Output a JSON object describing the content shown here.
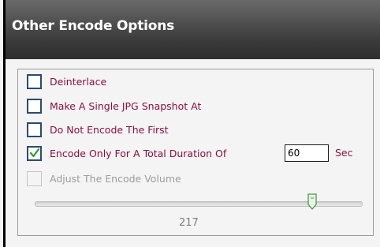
{
  "panel": {
    "title": "Other Encode Options"
  },
  "options": [
    {
      "label": "Deinterlace",
      "checked": false,
      "enabled": true
    },
    {
      "label": "Make A Single JPG Snapshot At",
      "checked": false,
      "enabled": true
    },
    {
      "label": "Do Not Encode The First",
      "checked": false,
      "enabled": true
    },
    {
      "label": "Encode Only For A Total Duration Of",
      "checked": true,
      "enabled": true
    },
    {
      "label": "Adjust The Encode Volume",
      "checked": false,
      "enabled": false
    }
  ],
  "duration": {
    "value": "60",
    "unit": "Sec"
  },
  "volume_slider": {
    "value": "217",
    "fraction": 0.86,
    "enabled": false
  },
  "colors": {
    "label": "#8b1040",
    "disabled_label": "#9c9c9c",
    "checkbox_border": "#2c4a6e",
    "checkmark": "#2e9a2e",
    "title_text": "#ffffff"
  },
  "icons": {
    "check": "checkmark-icon",
    "thumb": "slider-thumb-icon"
  }
}
